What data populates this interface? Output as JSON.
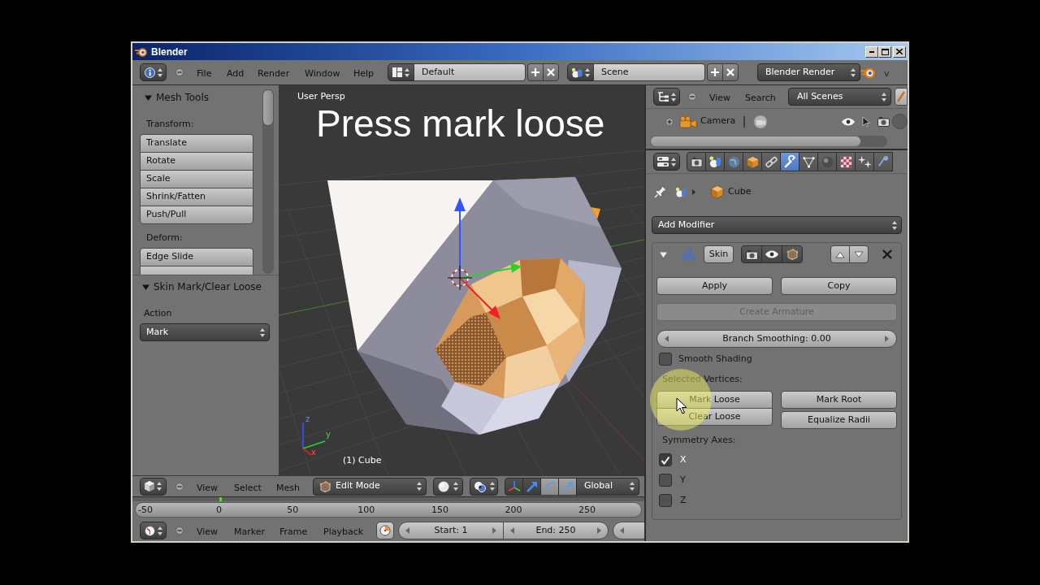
{
  "window": {
    "title": "Blender"
  },
  "info_header": {
    "menus": [
      "File",
      "Add",
      "Render",
      "Window",
      "Help"
    ],
    "screen_layout": "Default",
    "scene": "Scene",
    "render_engine": "Blender Render",
    "clipped_text": "v"
  },
  "tool_shelf": {
    "mesh_tools": {
      "title": "Mesh Tools",
      "expanded": true,
      "groups": [
        {
          "label": "Transform:",
          "buttons": [
            "Translate",
            "Rotate",
            "Scale",
            "Shrink/Fatten",
            "Push/Pull"
          ]
        },
        {
          "label": "Deform:",
          "buttons": [
            "Edge Slide"
          ]
        }
      ]
    },
    "operator": {
      "title": "Skin Mark/Clear Loose",
      "expanded": true,
      "label": "Action",
      "value": "Mark"
    }
  },
  "viewport": {
    "view_name": "User Persp",
    "caption": "Press mark loose",
    "axis_labels": [
      "z",
      "y",
      "x"
    ],
    "object_info": "(1) Cube"
  },
  "viewport_header": {
    "menus": [
      "View",
      "Select",
      "Mesh"
    ],
    "mode": "Edit Mode",
    "manipulators": [
      {
        "kind": "toggle",
        "selected": true
      },
      {
        "kind": "translate",
        "selected": true
      },
      {
        "kind": "rotate",
        "selected": false
      },
      {
        "kind": "scale",
        "selected": false
      }
    ],
    "orientation": "Global"
  },
  "timeline": {
    "ruler_labels": [
      "-50",
      "0",
      "50",
      "100",
      "150",
      "200",
      "250"
    ],
    "menus": [
      "View",
      "Marker",
      "Frame",
      "Playback"
    ],
    "start": "Start: 1",
    "end": "End: 250"
  },
  "outliner": {
    "menus": [
      "View",
      "Search"
    ],
    "display_mode": "All Scenes",
    "items": [
      {
        "name": "Camera",
        "expanded": false
      }
    ]
  },
  "properties": {
    "tabs": [
      {
        "kind": "render",
        "selected": false
      },
      {
        "kind": "scene",
        "selected": false
      },
      {
        "kind": "world",
        "selected": false
      },
      {
        "kind": "object",
        "selected": false
      },
      {
        "kind": "constraints",
        "selected": false
      },
      {
        "kind": "modifiers",
        "selected": true
      },
      {
        "kind": "data",
        "selected": false
      },
      {
        "kind": "material",
        "selected": false
      },
      {
        "kind": "texture",
        "selected": false
      },
      {
        "kind": "particles",
        "selected": false
      },
      {
        "kind": "physics",
        "selected": false
      }
    ],
    "context": "Cube",
    "add_modifier": "Add Modifier",
    "modifier": {
      "name": "Skin",
      "expanded": true,
      "buttons": [
        "Apply",
        "Copy"
      ],
      "create_armature": {
        "label": "Create Armature",
        "disabled": true
      },
      "branch_smoothing": "Branch Smoothing: 0.00",
      "smooth_shading": {
        "label": "Smooth Shading",
        "checked": false
      },
      "selected_vertices": {
        "label": "Selected Vertices:",
        "columns": [
          [
            "Mark Loose",
            "Clear Loose"
          ],
          [
            "Mark Root",
            "Equalize Radii"
          ]
        ]
      },
      "symmetry": {
        "label": "Symmetry Axes:",
        "axes": [
          {
            "label": "X",
            "checked": true
          },
          {
            "label": "Y",
            "checked": false
          },
          {
            "label": "Z",
            "checked": false
          }
        ]
      }
    }
  }
}
